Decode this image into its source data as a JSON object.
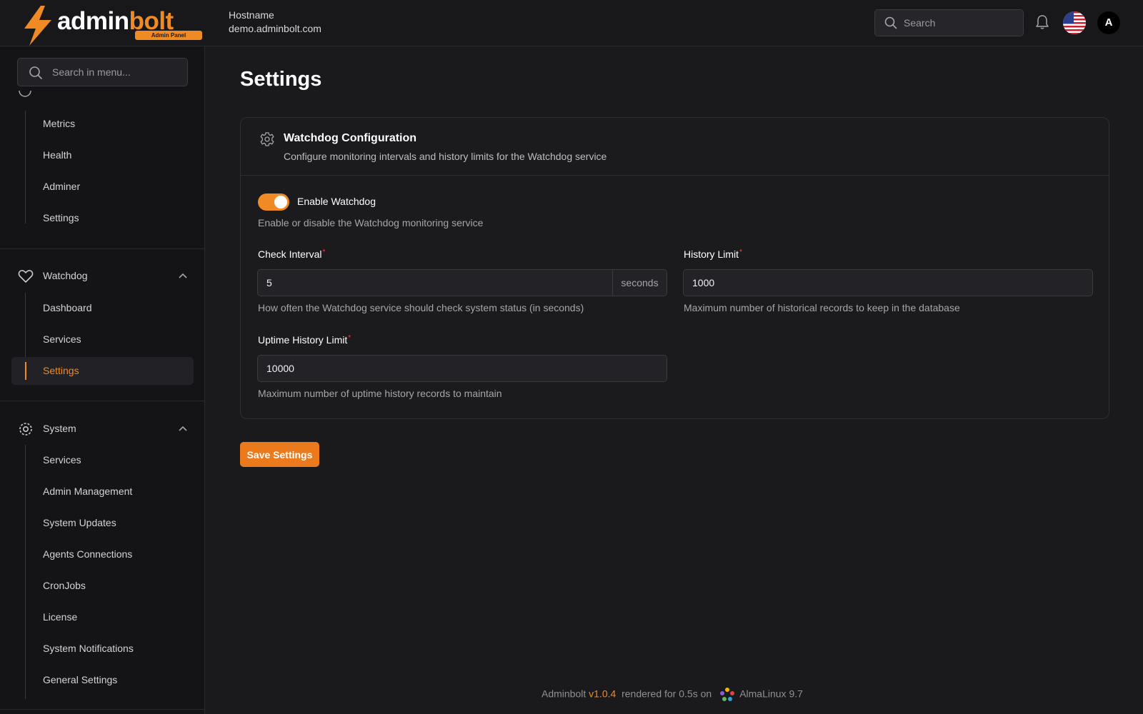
{
  "brand": {
    "name_main": "admin",
    "name_accent": "bolt",
    "badge": "Admin Panel",
    "accent_color": "#f08a24"
  },
  "header": {
    "hostname_label": "Hostname",
    "hostname_value": "demo.adminbolt.com",
    "search_placeholder": "Search",
    "language_flag": "us-flag-icon",
    "avatar_initial": "A"
  },
  "sidebar": {
    "search_placeholder": "Search in menu...",
    "top_items": [
      "Metrics",
      "Health",
      "Adminer",
      "Settings"
    ],
    "watchdog": {
      "label": "Watchdog",
      "items": [
        "Dashboard",
        "Services",
        "Settings"
      ],
      "active": "Settings"
    },
    "system": {
      "label": "System",
      "items": [
        "Services",
        "Admin Management",
        "System Updates",
        "Agents Connections",
        "CronJobs",
        "License",
        "System Notifications",
        "General Settings"
      ]
    }
  },
  "main": {
    "title": "Settings",
    "card": {
      "title": "Watchdog Configuration",
      "description": "Configure monitoring intervals and history limits for the Watchdog service",
      "toggle": {
        "label": "Enable Watchdog",
        "help": "Enable or disable the Watchdog monitoring service",
        "enabled": true
      },
      "fields": {
        "check_interval": {
          "label": "Check Interval",
          "required_mark": "*",
          "value": "5",
          "suffix": "seconds",
          "help": "How often the Watchdog service should check system status (in seconds)"
        },
        "history_limit": {
          "label": "History Limit",
          "required_mark": "*",
          "value": "1000",
          "help": "Maximum number of historical records to keep in the database"
        },
        "uptime_history_limit": {
          "label": "Uptime History Limit",
          "required_mark": "*",
          "value": "10000",
          "help": "Maximum number of uptime history records to maintain"
        }
      }
    },
    "save_label": "Save Settings"
  },
  "footer": {
    "app": "Adminbolt",
    "version": "v1.0.4",
    "rendered": "rendered for 0.5s on",
    "os": "AlmaLinux 9.7"
  }
}
